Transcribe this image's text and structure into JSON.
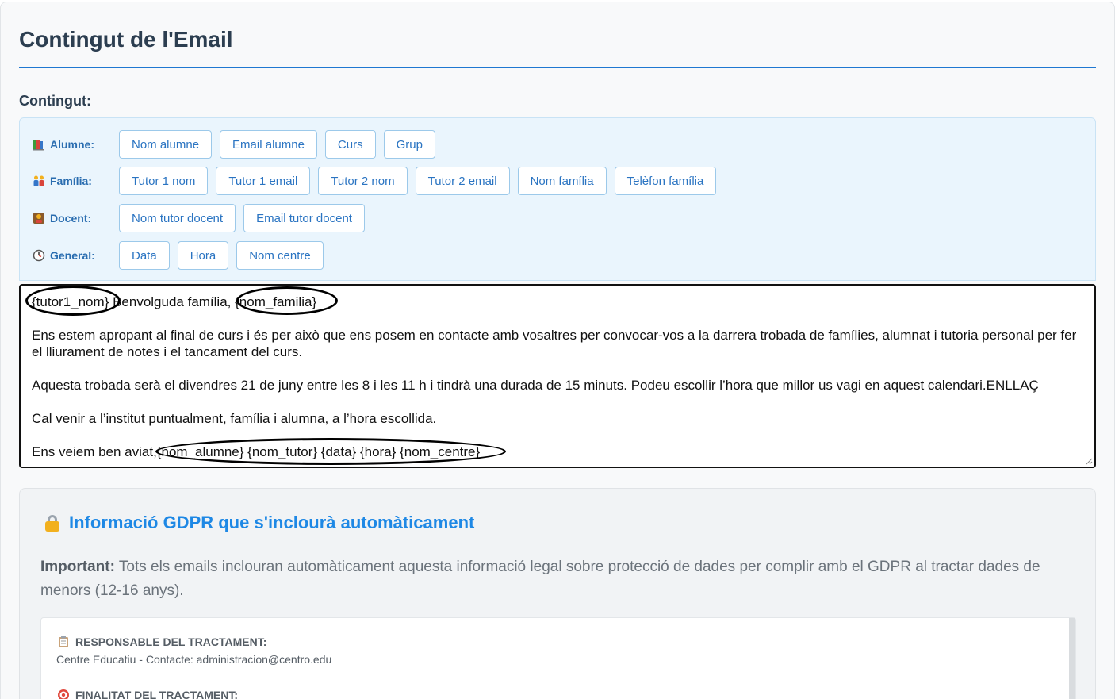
{
  "page_title": "Contingut de l'Email",
  "content_label": "Contingut:",
  "variable_groups": [
    {
      "label": "Alumne:",
      "icon": "books-icon",
      "buttons": [
        "Nom alumne",
        "Email alumne",
        "Curs",
        "Grup"
      ]
    },
    {
      "label": "Família:",
      "icon": "family-icon",
      "buttons": [
        "Tutor 1 nom",
        "Tutor 1 email",
        "Tutor 2 nom",
        "Tutor 2 email",
        "Nom família",
        "Telèfon família"
      ]
    },
    {
      "label": "Docent:",
      "icon": "teacher-icon",
      "buttons": [
        "Nom tutor docent",
        "Email tutor docent"
      ]
    },
    {
      "label": "General:",
      "icon": "clock-icon",
      "buttons": [
        "Data",
        "Hora",
        "Nom centre"
      ]
    }
  ],
  "editor": {
    "lines": [
      "{tutor1_nom} Benvolguda família, {nom_familia}",
      "",
      "Ens estem apropant al final de curs i és per això que ens posem en contacte amb vosaltres per convocar-vos a la darrera trobada de famílies, alumnat i tutoria personal per fer el lliurament de notes i el tancament del curs.",
      "",
      "Aquesta trobada serà el divendres 21 de juny entre les 8 i les 11 h i tindrà una durada de 15 minuts. Podeu escollir l’hora que millor us vagi en aquest calendari.ENLLAÇ",
      "",
      "Cal venir a l’institut puntualment, família i alumna, a l’hora escollida.",
      "",
      "Ens veiem ben aviat,{nom_alumne} {nom_tutor} {data} {hora} {nom_centre}"
    ]
  },
  "gdpr": {
    "title": "Informació GDPR que s'inclourà automàticament",
    "intro_bold": "Important:",
    "intro_text": " Tots els emails inclouran automàticament aquesta informació legal sobre protecció de dades per complir amb el GDPR al tractar dades de menors (12-16 anys).",
    "sections": [
      {
        "heading": "RESPONSABLE DEL TRACTAMENT:",
        "icon": "clipboard-icon",
        "text": "Centre Educatiu - Contacte: administracion@centro.edu"
      },
      {
        "heading": "FINALITAT DEL TRACTAMENT:",
        "icon": "target-icon",
        "text": ""
      }
    ]
  }
}
